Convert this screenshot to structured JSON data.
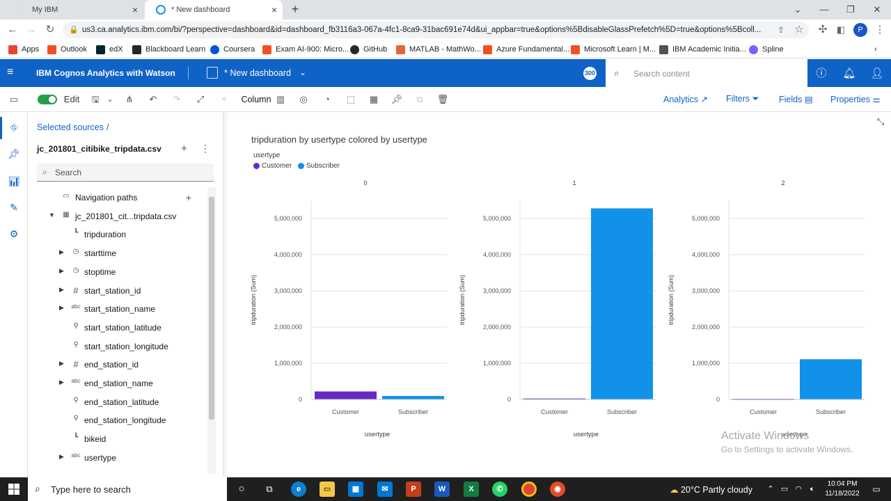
{
  "browser": {
    "tabs": [
      {
        "title": "My IBM"
      },
      {
        "title": "* New dashboard"
      }
    ],
    "url": "us3.ca.analytics.ibm.com/bi/?perspective=dashboard&id=dashboard_fb3116a3-067a-4fc1-8ca9-31bac691e74d&ui_appbar=true&options%5BdisableGlassPrefetch%5D=true&options%5Bcoll...",
    "profile_initial": "P",
    "bookmarks": [
      {
        "label": "Apps",
        "icon": "apps-grid-icon",
        "color": "#ea4335"
      },
      {
        "label": "Outlook",
        "icon": "microsoft-icon",
        "color": "#f25022"
      },
      {
        "label": "edX",
        "icon": "edx-icon",
        "color": "#02262b"
      },
      {
        "label": "Blackboard Learn",
        "icon": "blackboard-icon",
        "color": "#262626"
      },
      {
        "label": "Coursera",
        "icon": "coursera-icon",
        "color": "#0056d2"
      },
      {
        "label": "Exam AI-900: Micro...",
        "icon": "microsoft-icon",
        "color": "#f25022"
      },
      {
        "label": "GitHub",
        "icon": "github-icon",
        "color": "#24292e"
      },
      {
        "label": "MATLAB - MathWo...",
        "icon": "matlab-icon",
        "color": "#e16737"
      },
      {
        "label": "Azure Fundamental...",
        "icon": "microsoft-icon",
        "color": "#f25022"
      },
      {
        "label": "Microsoft Learn | M...",
        "icon": "microsoft-icon",
        "color": "#f25022"
      },
      {
        "label": "IBM Academic Initia...",
        "icon": "ibm-icon",
        "color": "#525252"
      },
      {
        "label": "Spline",
        "icon": "spline-icon",
        "color": "#7b61ff"
      }
    ]
  },
  "app": {
    "title": "IBM Cognos Analytics with Watson",
    "dashboard_title": "* New dashboard",
    "notification_count": "300",
    "search_placeholder": "Search content",
    "brand_color": "#0f62c6"
  },
  "toolbar": {
    "edit_label": "Edit",
    "viz_type_label": "Column",
    "analytics_label": "Analytics",
    "filters_label": "Filters",
    "fields_label": "Fields",
    "properties_label": "Properties"
  },
  "datapanel": {
    "breadcrumb": "Selected sources",
    "breadcrumb_sep": "/",
    "source_name": "jc_201801_citibike_tripdata.csv",
    "search_placeholder": "Search",
    "tree": [
      {
        "label": "Navigation paths",
        "icon": "folder-icon",
        "glyph": "▭",
        "expander": ""
      },
      {
        "label": "jc_201801_cit...tripdata.csv",
        "icon": "table-icon",
        "glyph": "▦",
        "expander": "▼"
      },
      {
        "label": "tripduration",
        "icon": "measure-icon",
        "glyph": "┗",
        "expander": ""
      },
      {
        "label": "starttime",
        "icon": "clock-icon",
        "glyph": "◷",
        "expander": "▶"
      },
      {
        "label": "stoptime",
        "icon": "clock-icon",
        "glyph": "◷",
        "expander": "▶"
      },
      {
        "label": "start_station_id",
        "icon": "hash-icon",
        "glyph": "#",
        "expander": "▶"
      },
      {
        "label": "start_station_name",
        "icon": "text-abc-icon",
        "glyph": "abc",
        "expander": "▶"
      },
      {
        "label": "start_station_latitude",
        "icon": "location-pin-icon",
        "glyph": "⚲",
        "expander": ""
      },
      {
        "label": "start_station_longitude",
        "icon": "location-pin-icon",
        "glyph": "⚲",
        "expander": ""
      },
      {
        "label": "end_station_id",
        "icon": "hash-icon",
        "glyph": "#",
        "expander": "▶"
      },
      {
        "label": "end_station_name",
        "icon": "text-abc-icon",
        "glyph": "abc",
        "expander": "▶"
      },
      {
        "label": "end_station_latitude",
        "icon": "location-pin-icon",
        "glyph": "⚲",
        "expander": ""
      },
      {
        "label": "end_station_longitude",
        "icon": "location-pin-icon",
        "glyph": "⚲",
        "expander": ""
      },
      {
        "label": "bikeid",
        "icon": "measure-icon",
        "glyph": "┗",
        "expander": ""
      },
      {
        "label": "usertype",
        "icon": "text-abc-icon",
        "glyph": "abc",
        "expander": "▶"
      }
    ]
  },
  "chart_data": {
    "type": "bar",
    "title": "tripduration by usertype colored by usertype",
    "legend_title": "usertype",
    "legend_position": "top-left",
    "legend": [
      {
        "name": "Customer",
        "color": "#6929c4"
      },
      {
        "name": "Subscriber",
        "color": "#1192e8"
      }
    ],
    "ylabel": "tripduration (Sum)",
    "xlabel": "usertype",
    "ylim": [
      0,
      5000000
    ],
    "yticks": [
      0,
      1000000,
      2000000,
      3000000,
      4000000,
      5000000
    ],
    "ytick_labels": [
      "0",
      "1,000,000",
      "2,000,000",
      "3,000,000",
      "4,000,000",
      "5,000,000"
    ],
    "grid": true,
    "categories": [
      "Customer",
      "Subscriber"
    ],
    "panels": [
      {
        "label": "0",
        "values": [
          220000,
          95000
        ]
      },
      {
        "label": "1",
        "values": [
          25000,
          5280000
        ]
      },
      {
        "label": "2",
        "values": [
          15000,
          1110000
        ]
      }
    ]
  },
  "watermark": {
    "line1": "Activate Windows",
    "line2": "Go to Settings to activate Windows."
  },
  "taskbar": {
    "search_placeholder": "Type here to search",
    "weather": "20°C  Partly cloudy",
    "time": "10:04 PM",
    "date": "11/18/2022"
  }
}
